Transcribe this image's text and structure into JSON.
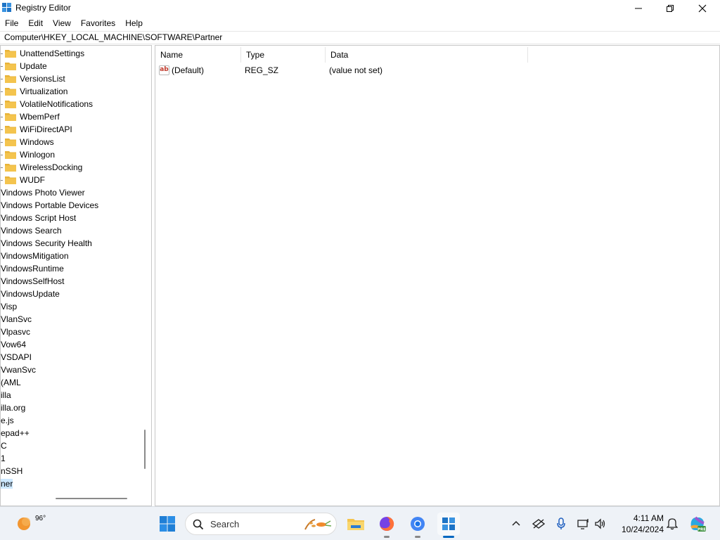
{
  "window": {
    "title": "Registry Editor",
    "minimize_label": "Minimize",
    "maximize_label": "Restore",
    "close_label": "Close"
  },
  "menu": [
    "File",
    "Edit",
    "View",
    "Favorites",
    "Help"
  ],
  "address": "Computer\\HKEY_LOCAL_MACHINE\\SOFTWARE\\Partner",
  "tree": {
    "folders": [
      "UnattendSettings",
      "Update",
      "VersionsList",
      "Virtualization",
      "VolatileNotifications",
      "WbemPerf",
      "WiFiDirectAPI",
      "Windows",
      "Winlogon",
      "WirelessDocking",
      "WUDF"
    ],
    "clipped": [
      "Vindows Photo Viewer",
      "Vindows Portable Devices",
      "Vindows Script Host",
      "Vindows Search",
      "Vindows Security Health",
      "VindowsMitigation",
      "VindowsRuntime",
      "VindowsSelfHost",
      "VindowsUpdate",
      "Visp",
      "VlanSvc",
      "Vlpasvc",
      "Vow64",
      "VSDAPI",
      "VwanSvc",
      "(AML",
      "illa",
      "illa.org",
      "e.js",
      "epad++",
      "C",
      "1",
      "nSSH",
      "ner"
    ],
    "selected_index": 23
  },
  "values": {
    "columns": [
      "Name",
      "Type",
      "Data"
    ],
    "rows": [
      {
        "icon": "string-value-icon",
        "name": "(Default)",
        "type": "REG_SZ",
        "data": "(value not set)"
      }
    ]
  },
  "taskbar": {
    "weather_temp": "96°",
    "search_placeholder": "Search",
    "time": "4:11 AM",
    "date": "10/24/2024"
  },
  "colors": {
    "accent": "#0067c0",
    "folder": "#f4c44e",
    "selection": "#cce8ff"
  }
}
